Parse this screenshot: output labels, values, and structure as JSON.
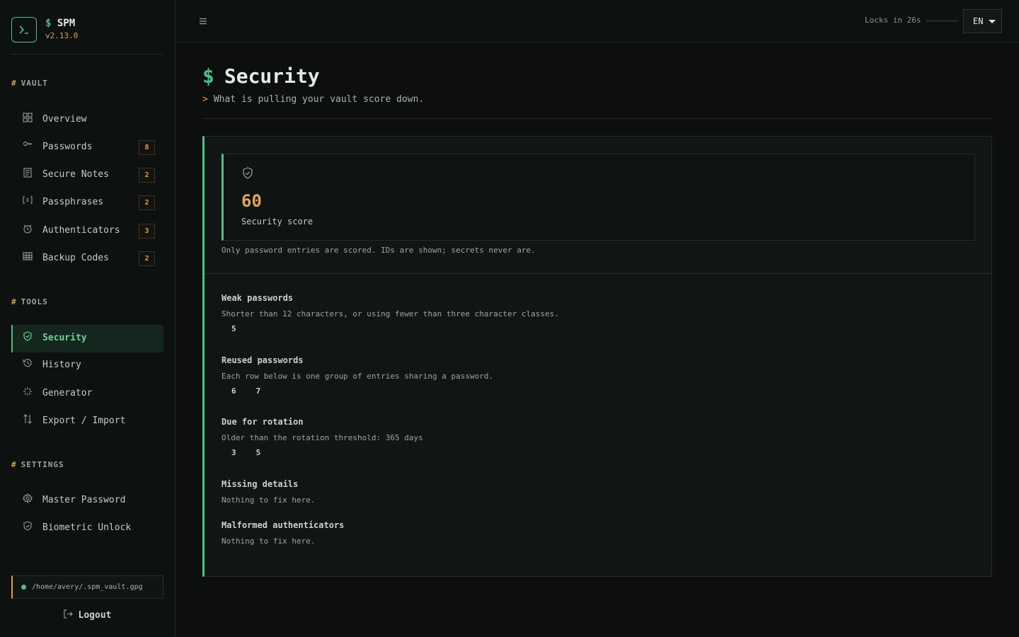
{
  "brand": {
    "prompt": "$",
    "name": "SPM",
    "version": "v2.13.0"
  },
  "sidebar": {
    "vault_title": "VAULT",
    "tools_title": "TOOLS",
    "settings_title": "SETTINGS",
    "section_prefix": "#",
    "vault_items": [
      {
        "label": "Overview",
        "icon": "grid-icon"
      },
      {
        "label": "Passwords",
        "icon": "key-icon",
        "badge": "8"
      },
      {
        "label": "Secure Notes",
        "icon": "note-icon",
        "badge": "2"
      },
      {
        "label": "Passphrases",
        "icon": "brackets-icon",
        "badge": "2"
      },
      {
        "label": "Authenticators",
        "icon": "timer-icon",
        "badge": "3"
      },
      {
        "label": "Backup Codes",
        "icon": "table-icon",
        "badge": "2"
      }
    ],
    "tools_items": [
      {
        "label": "Security",
        "icon": "shield-icon",
        "active": true
      },
      {
        "label": "History",
        "icon": "history-icon"
      },
      {
        "label": "Generator",
        "icon": "sparkle-icon"
      },
      {
        "label": "Export / Import",
        "icon": "transfer-icon"
      }
    ],
    "settings_items": [
      {
        "label": "Master Password",
        "icon": "gear-icon"
      },
      {
        "label": "Biometric Unlock",
        "icon": "shield-icon"
      }
    ],
    "vault_path": "/home/avery/.spm_vault.gpg",
    "logout_label": "Logout"
  },
  "topbar": {
    "lock_text": "Locks in 26s",
    "lock_progress": 0.02,
    "language": "EN"
  },
  "page": {
    "prompt": "$",
    "title": "Security",
    "subtitle_prefix": ">",
    "subtitle": "What is pulling your vault score down."
  },
  "score": {
    "value": "60",
    "label": "Security score",
    "note": "Only password entries are scored. IDs are shown; secrets never are."
  },
  "issues": [
    {
      "title": "Weak passwords",
      "desc": "Shorter than 12 characters, or using fewer than three character classes.",
      "ids": [
        "5"
      ]
    },
    {
      "title": "Reused passwords",
      "desc": "Each row below is one group of entries sharing a password.",
      "ids": [
        "6",
        "7"
      ]
    },
    {
      "title": "Due for rotation",
      "desc": "Older than the rotation threshold: 365 days",
      "ids": [
        "3",
        "5"
      ]
    },
    {
      "title": "Missing details",
      "desc": "Nothing to fix here.",
      "ids": []
    },
    {
      "title": "Malformed authenticators",
      "desc": "Nothing to fix here.",
      "ids": []
    }
  ],
  "colors": {
    "accent": "#4fbf85",
    "warning": "#d9a441",
    "score": "#e0a45b",
    "background": "#0c0f0e"
  }
}
